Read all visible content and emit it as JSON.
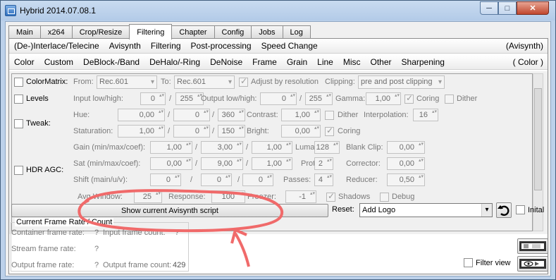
{
  "window": {
    "title": "Hybrid 2014.07.08.1",
    "min": "─",
    "max": "□",
    "close": "✕"
  },
  "tabs": [
    "Main",
    "x264",
    "Crop/Resize",
    "Filtering",
    "Chapter",
    "Config",
    "Jobs",
    "Log"
  ],
  "menubar1": {
    "items": [
      "(De-)Interlace/Telecine",
      "Avisynth",
      "Filtering",
      "Post-processing",
      "Speed Change"
    ],
    "right": "(Avisynth)"
  },
  "menubar2": {
    "items": [
      "Color",
      "Custom",
      "DeBlock-/Band",
      "DeHalo/-Ring",
      "DeNoise",
      "Frame",
      "Grain",
      "Line",
      "Misc",
      "Other",
      "Sharpening"
    ],
    "right": "( Color )"
  },
  "color": {
    "colormatrix": {
      "label": "ColorMatrix:",
      "from_label": "From:",
      "from": "Rec.601",
      "to_label": "To:",
      "to": "Rec.601",
      "adjust": "Adjust by resolution",
      "clipping_label": "Clipping:",
      "clipping": "pre and post clipping"
    },
    "levels": {
      "label": "Levels",
      "input_label": "Input low/high:",
      "in_low": "0",
      "in_high": "255",
      "output_label": "Output low/high:",
      "out_low": "0",
      "out_high": "255",
      "gamma_label": "Gamma:",
      "gamma": "1,00",
      "coring": "Coring",
      "dither": "Dither"
    },
    "tweak": {
      "label": "Tweak:",
      "hue_label": "Hue:",
      "hue_a": "0,00",
      "hue_b": "0",
      "hue_c": "360",
      "contrast_label": "Contrast:",
      "contrast": "1,00",
      "dither": "Dither",
      "interp_label": "Interpolation:",
      "interp": "16",
      "sat_label": "Staturation:",
      "sat_a": "1,00",
      "sat_b": "0",
      "sat_c": "150",
      "bright_label": "Bright:",
      "bright": "0,00",
      "coring": "Coring"
    },
    "hdr": {
      "label": "HDR AGC:",
      "gain_label": "Gain (min/max/coef):",
      "gain_a": "1,00",
      "gain_b": "3,00",
      "gain_c": "1,00",
      "luma_label": "Luma:",
      "luma": "128",
      "blank_label": "Blank Clip:",
      "blank": "0,00",
      "sat_label": "Sat (min/max/coef):",
      "sat_a": "0,00",
      "sat_b": "9,00",
      "sat_c": "1,00",
      "protect_label": "Protect:",
      "protect": "2",
      "corrector_label": "Corrector:",
      "corrector": "0,00",
      "shift_label": "Shift (main/u/v):",
      "shift_a": "0",
      "shift_b": "0",
      "shift_c": "0",
      "passes_label": "Passes:",
      "passes": "4",
      "reducer_label": "Reducer:",
      "reducer": "0,50",
      "avg_label": "Avg Window:",
      "avg": "25",
      "response_label": "Response:",
      "response": "100",
      "freezer_label": "Freezer:",
      "freezer": "-1",
      "shadows": "Shadows",
      "debug": "Debug"
    }
  },
  "bottom": {
    "show_script": "Show current Avisynth script",
    "reset_label": "Reset:",
    "reset_value": "Add Logo",
    "initial": "Inital",
    "filter_view": "Filter view"
  },
  "frame": {
    "legend": "Current Frame Rate / Count",
    "container": "Container frame rate:",
    "container_val": "?",
    "input_count": "Input frame count:",
    "input_val": "?",
    "stream": "Stream frame rate:",
    "stream_val": "?",
    "output": "Output frame rate:",
    "output_val": "?",
    "output_count": "Output frame count:",
    "output_count_val": "429"
  },
  "colors": {
    "annotation": "#f06a6a",
    "window_frame": "#bcd1ea"
  }
}
